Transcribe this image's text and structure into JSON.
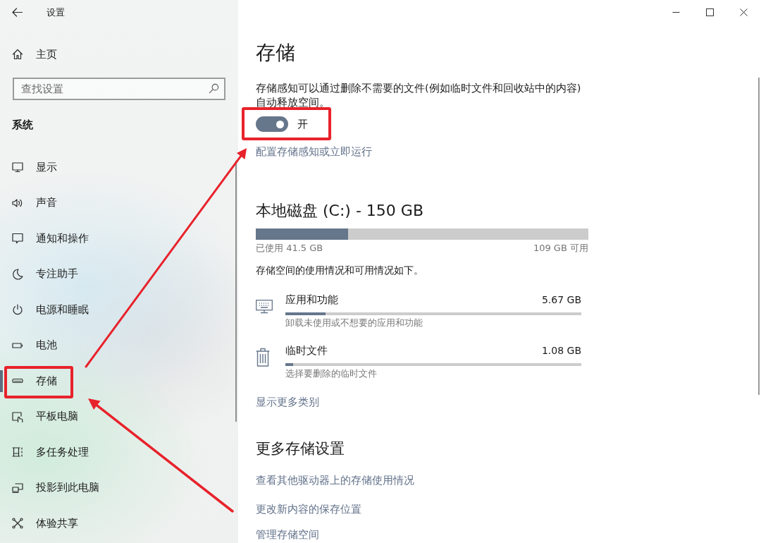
{
  "window": {
    "title": "设置"
  },
  "sidebar": {
    "home": {
      "label": "主页"
    },
    "search": {
      "placeholder": "查找设置"
    },
    "section_title": "系统",
    "items": [
      {
        "label": "显示",
        "selected": false,
        "highlighted": false
      },
      {
        "label": "声音",
        "selected": false,
        "highlighted": false
      },
      {
        "label": "通知和操作",
        "selected": false,
        "highlighted": false
      },
      {
        "label": "专注助手",
        "selected": false,
        "highlighted": false
      },
      {
        "label": "电源和睡眠",
        "selected": false,
        "highlighted": false
      },
      {
        "label": "电池",
        "selected": false,
        "highlighted": false
      },
      {
        "label": "存储",
        "selected": true,
        "highlighted": true
      },
      {
        "label": "平板电脑",
        "selected": false,
        "highlighted": false
      },
      {
        "label": "多任务处理",
        "selected": false,
        "highlighted": false
      },
      {
        "label": "投影到此电脑",
        "selected": false,
        "highlighted": false
      },
      {
        "label": "体验共享",
        "selected": false,
        "highlighted": false
      }
    ]
  },
  "main": {
    "title": "存储",
    "storage_sense": {
      "description": "存储感知可以通过删除不需要的文件(例如临时文件和回收站中的内容)自动释放空间。",
      "toggle": {
        "on": true,
        "label": "开",
        "highlighted": true
      },
      "link": "配置存储感知或立即运行"
    },
    "drive": {
      "title": "本地磁盘 (C:) - 150 GB",
      "level": 0.277,
      "used": "已使用 41.5 GB",
      "free": "109 GB 可用",
      "summary": "存储空间的使用情况和可用情况如下。",
      "categories": [
        {
          "name": "应用和功能",
          "size": "5.67 GB",
          "level": 0.136,
          "hint": "卸载未使用或不想要的应用和功能"
        },
        {
          "name": "临时文件",
          "size": "1.08 GB",
          "level": 0.026,
          "hint": "选择要删除的临时文件"
        }
      ],
      "more_link": "显示更多类别"
    },
    "more_settings": {
      "title": "更多存储设置",
      "links": [
        "查看其他驱动器上的存储使用情况",
        "更改新内容的保存位置",
        "管理存储空间"
      ]
    }
  }
}
